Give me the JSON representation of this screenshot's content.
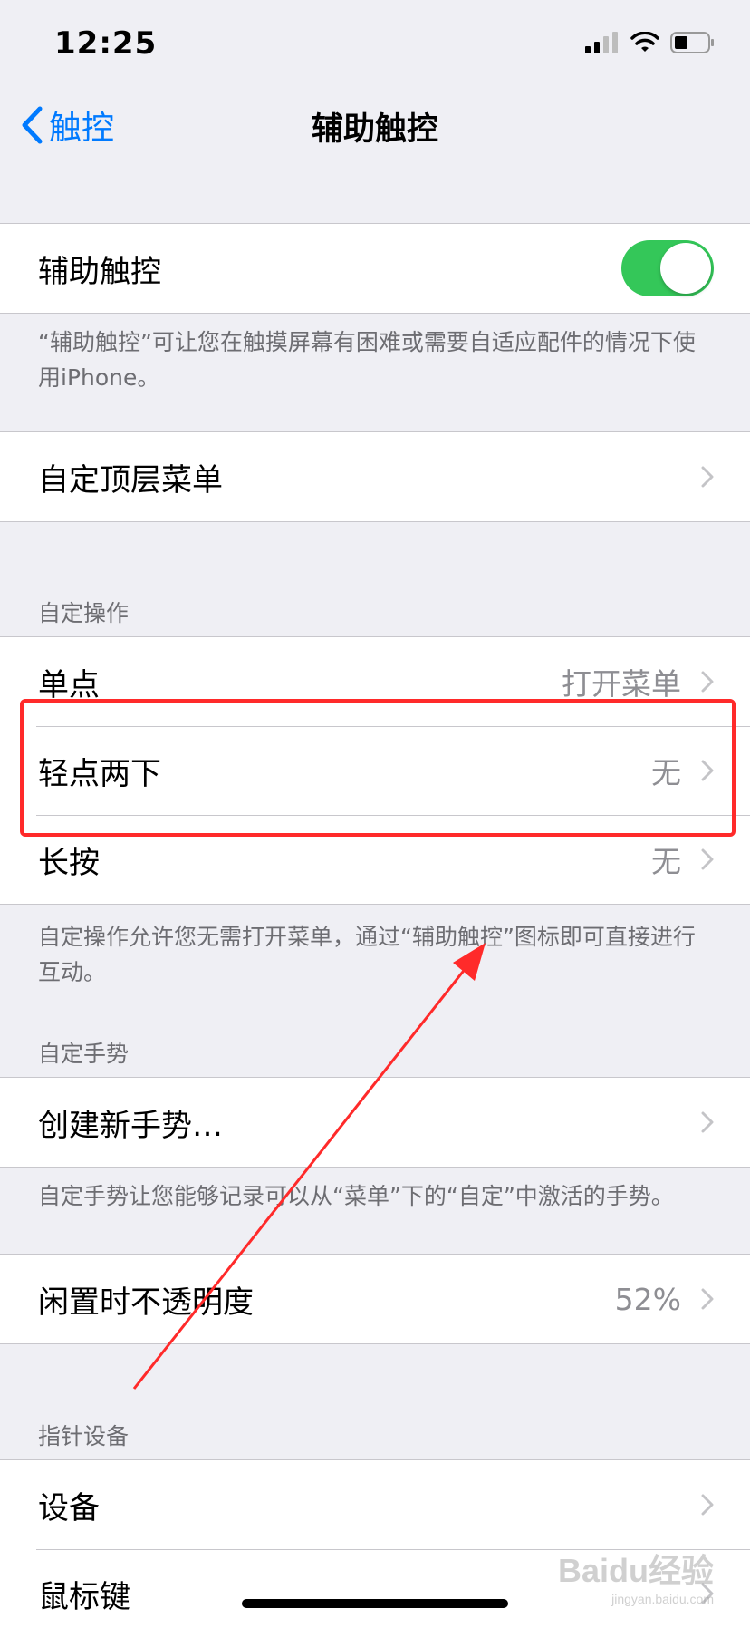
{
  "status_bar": {
    "time": "12:25"
  },
  "nav": {
    "back_label": "触控",
    "title": "辅助触控"
  },
  "assistive_touch": {
    "label": "辅助触控",
    "enabled": true,
    "footer": "“辅助触控”可让您在触摸屏幕有困难或需要自适应配件的情况下使用iPhone。"
  },
  "top_menu": {
    "label": "自定顶层菜单"
  },
  "custom_actions": {
    "header": "自定操作",
    "items": [
      {
        "label": "单点",
        "value": "打开菜单"
      },
      {
        "label": "轻点两下",
        "value": "无"
      },
      {
        "label": "长按",
        "value": "无"
      }
    ],
    "footer": "自定操作允许您无需打开菜单，通过“辅助触控”图标即可直接进行互动。"
  },
  "custom_gestures": {
    "header": "自定手势",
    "create_label": "创建新手势…",
    "footer": "自定手势让您能够记录可以从“菜单”下的“自定”中激活的手势。"
  },
  "idle_opacity": {
    "label": "闲置时不透明度",
    "value": "52%"
  },
  "pointer_devices": {
    "header": "指针设备",
    "items": [
      {
        "label": "设备"
      },
      {
        "label": "鼠标键"
      }
    ]
  },
  "watermark": {
    "brand": "Baidu经验",
    "url": "jingyan.baidu.com"
  },
  "colors": {
    "accent": "#007aff",
    "toggle_on": "#34c759",
    "annotation": "#ff2a2a"
  }
}
